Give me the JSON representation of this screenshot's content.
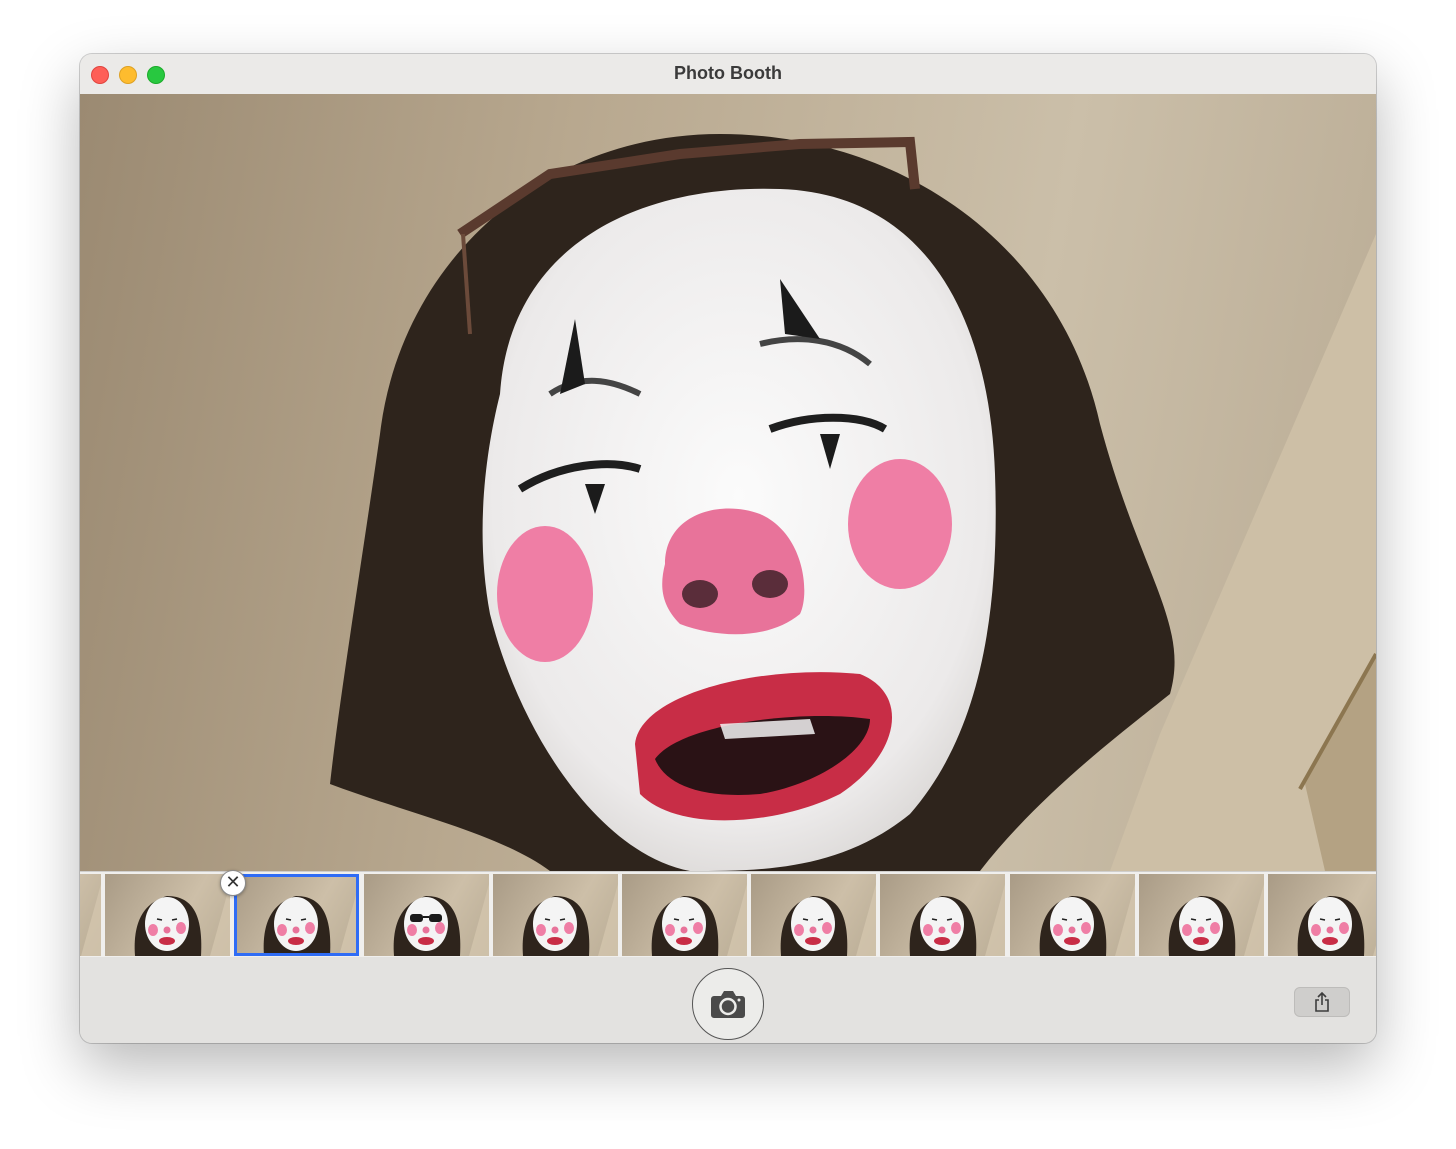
{
  "window": {
    "title": "Photo Booth",
    "controls": [
      "close",
      "minimize",
      "zoom"
    ]
  },
  "preview": {
    "description_icon": "live-camera-preview"
  },
  "filmstrip": {
    "thumbnails": [
      {
        "id": 0,
        "partial": true
      },
      {
        "id": 1
      },
      {
        "id": 2,
        "selected": true
      },
      {
        "id": 3,
        "sunglasses": true
      },
      {
        "id": 4
      },
      {
        "id": 5
      },
      {
        "id": 6
      },
      {
        "id": 7
      },
      {
        "id": 8
      },
      {
        "id": 9
      },
      {
        "id": 10,
        "partial": true
      }
    ],
    "delete_glyph": "✕",
    "selected_color": "#2f6cf5"
  },
  "toolbar": {
    "shutter_icon": "camera-icon",
    "share_icon": "share-icon"
  }
}
